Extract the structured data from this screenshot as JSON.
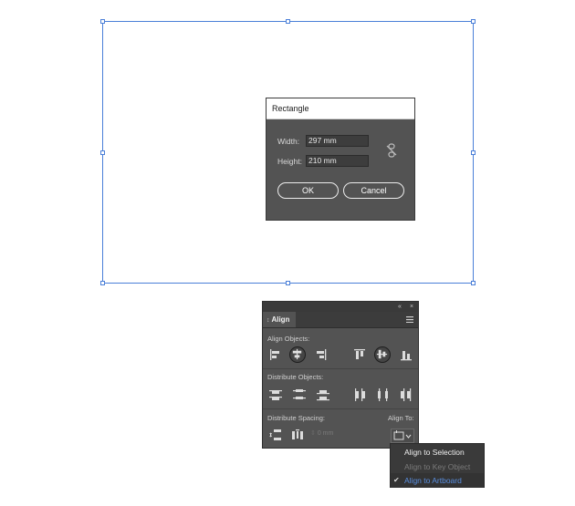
{
  "dialog": {
    "title": "Rectangle",
    "width_label": "Width:",
    "width_value": "297 mm",
    "height_label": "Height:",
    "height_value": "210 mm",
    "ok_label": "OK",
    "cancel_label": "Cancel"
  },
  "panel": {
    "tab_label": "Align",
    "tab_collapse_glyph": "↕",
    "collapse_glyph": "«",
    "close_glyph": "×",
    "align_objects_label": "Align Objects:",
    "distribute_objects_label": "Distribute Objects:",
    "distribute_spacing_label": "Distribute Spacing:",
    "spacing_value": "0 mm",
    "align_to_label": "Align To:"
  },
  "dropdown": {
    "items": [
      {
        "label": "Align to Selection",
        "state": "enabled"
      },
      {
        "label": "Align to Key Object",
        "state": "disabled"
      },
      {
        "label": "Align to Artboard",
        "state": "checked"
      }
    ],
    "check_glyph": "✔"
  },
  "colors": {
    "selection_blue": "#4a7fd8",
    "panel_bg": "#535353",
    "checked_item": "#5a8fe0"
  }
}
